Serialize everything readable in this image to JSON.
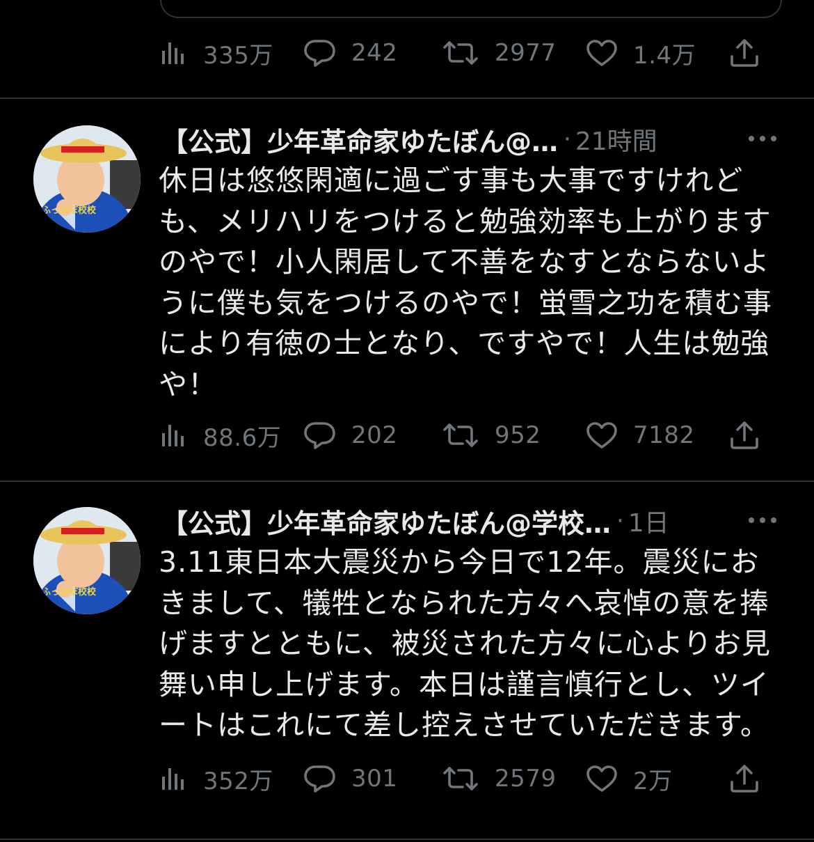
{
  "tweets": [
    {
      "views": "335万",
      "replies": "242",
      "retweets": "2977",
      "likes": "1.4万"
    },
    {
      "name": "【公式】少年革命家ゆたぼん@…",
      "separator": "·",
      "time": "21時間",
      "lines": [
        "休日は悠悠閑適に過ごす事も大事ですけれど",
        "も、メリハリをつけると勉強効率も上がります",
        "のやで！小人閑居して不善をなすとならないよ",
        "うに僕も気をつけるのやで！蛍雪之功を積む事",
        "により有徳の士となり、ですやで！人生は勉強",
        "や！"
      ],
      "views": "88.6万",
      "replies": "202",
      "retweets": "952",
      "likes": "7182"
    },
    {
      "name": "【公式】少年革命家ゆたぼん@学校…",
      "separator": "·",
      "time": "1日",
      "lines": [
        "3.11東日本大震災から今日で12年。震災にお",
        "きまして、犠牲となられた方々へ哀悼の意を捧",
        "げますとともに、被災された方々に心よりお見",
        "舞い申し上げます。本日は謹言慎行とし、ツイ",
        "ートはこれにて差し控えさせていただきます。"
      ],
      "views": "352万",
      "replies": "301",
      "retweets": "2579",
      "likes": "2万"
    }
  ],
  "icons": {
    "views": "views-bar-chart-icon",
    "reply": "reply-bubble-icon",
    "retweet": "retweet-arrows-icon",
    "like": "heart-icon",
    "share": "share-upload-icon",
    "more": "more-dots-icon"
  },
  "colors": {
    "background": "#000000",
    "text": "#e7e9ea",
    "muted": "#71767b",
    "divider": "#2f3336"
  }
}
